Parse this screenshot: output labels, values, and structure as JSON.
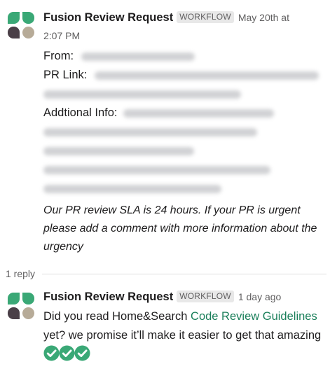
{
  "message1": {
    "app_name": "Fusion Review Request",
    "badge": "WORKFLOW",
    "timestamp_part1": "May 20th at",
    "timestamp_part2": "2:07 PM",
    "fields": [
      {
        "label": "From:"
      },
      {
        "label": "PR Link:"
      },
      {
        "label": "Addtional Info:"
      }
    ],
    "note": "Our PR review SLA is 24 hours. If your PR is urgent please add a comment with more information about the urgency"
  },
  "thread": {
    "reply_count": "1 reply"
  },
  "message2": {
    "app_name": "Fusion Review Request",
    "badge": "WORKFLOW",
    "timestamp": "1 day ago",
    "text_before_link": "Did you read Home&Search ",
    "link_text": "Code Review Guidelines",
    "text_after_link": " yet? we promise it’ll make it easier to get that amazing ",
    "emoji": [
      "white-check-mark",
      "white-check-mark",
      "white-check-mark"
    ]
  },
  "colors": {
    "avatar_green": "#3aa876",
    "avatar_dark": "#4a3f47",
    "avatar_tan": "#b7ab98",
    "link": "#1a7f5a",
    "check_green": "#3aa876"
  }
}
